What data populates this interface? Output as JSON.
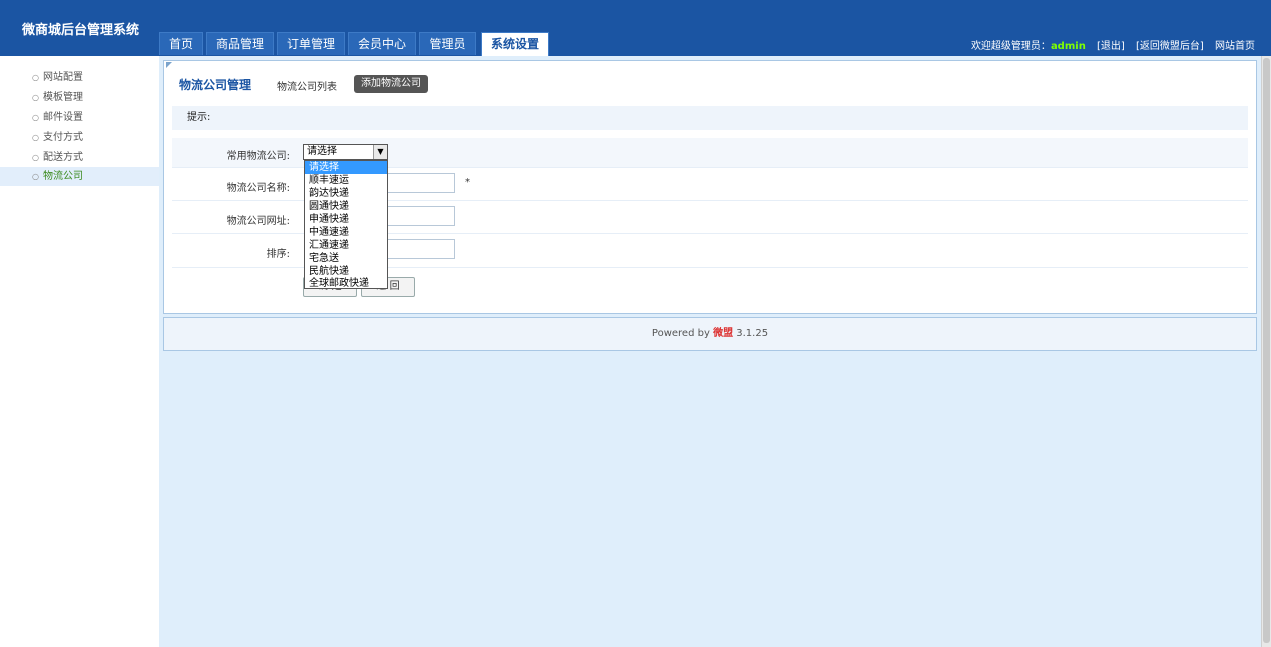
{
  "header": {
    "title": "微商城后台管理系统",
    "tabs": [
      {
        "label": "首页"
      },
      {
        "label": "商品管理"
      },
      {
        "label": "订单管理"
      },
      {
        "label": "会员中心"
      },
      {
        "label": "管理员"
      },
      {
        "label": "系统设置",
        "active": true
      }
    ],
    "welcome": "欢迎超级管理员：",
    "user": "admin",
    "links": [
      "[退出]",
      "[返回微盟后台]",
      "网站首页"
    ]
  },
  "sidebar": {
    "items": [
      {
        "label": "网站配置"
      },
      {
        "label": "模板管理"
      },
      {
        "label": "邮件设置"
      },
      {
        "label": "支付方式"
      },
      {
        "label": "配送方式"
      },
      {
        "label": "物流公司",
        "active": true
      }
    ]
  },
  "panel": {
    "title": "物流公司管理",
    "list_link": "物流公司列表",
    "add_button": "添加物流公司",
    "tip": "提示:"
  },
  "form": {
    "common_label": "常用物流公司:",
    "name_label": "物流公司名称:",
    "url_label": "物流公司网址:",
    "sort_label": "排序:",
    "required_mark": "*",
    "select_value": "请选择",
    "options": [
      "请选择",
      "顺丰速运",
      "韵达快递",
      "圆通快递",
      "申通快递",
      "中通速递",
      "汇通速递",
      "宅急送",
      "民航快递",
      "全球邮政快递"
    ],
    "submit_label": "确 定",
    "back_label": "返 回"
  },
  "footer": {
    "powered": "Powered by",
    "brand": "微盟",
    "version": "3.1.25"
  },
  "colors": {
    "header_bg": "#1b55a3",
    "main_bg": "#dfeefb",
    "active_sidebar_text": "#3a8a1c",
    "dropdown_highlight": "#3399ff"
  }
}
